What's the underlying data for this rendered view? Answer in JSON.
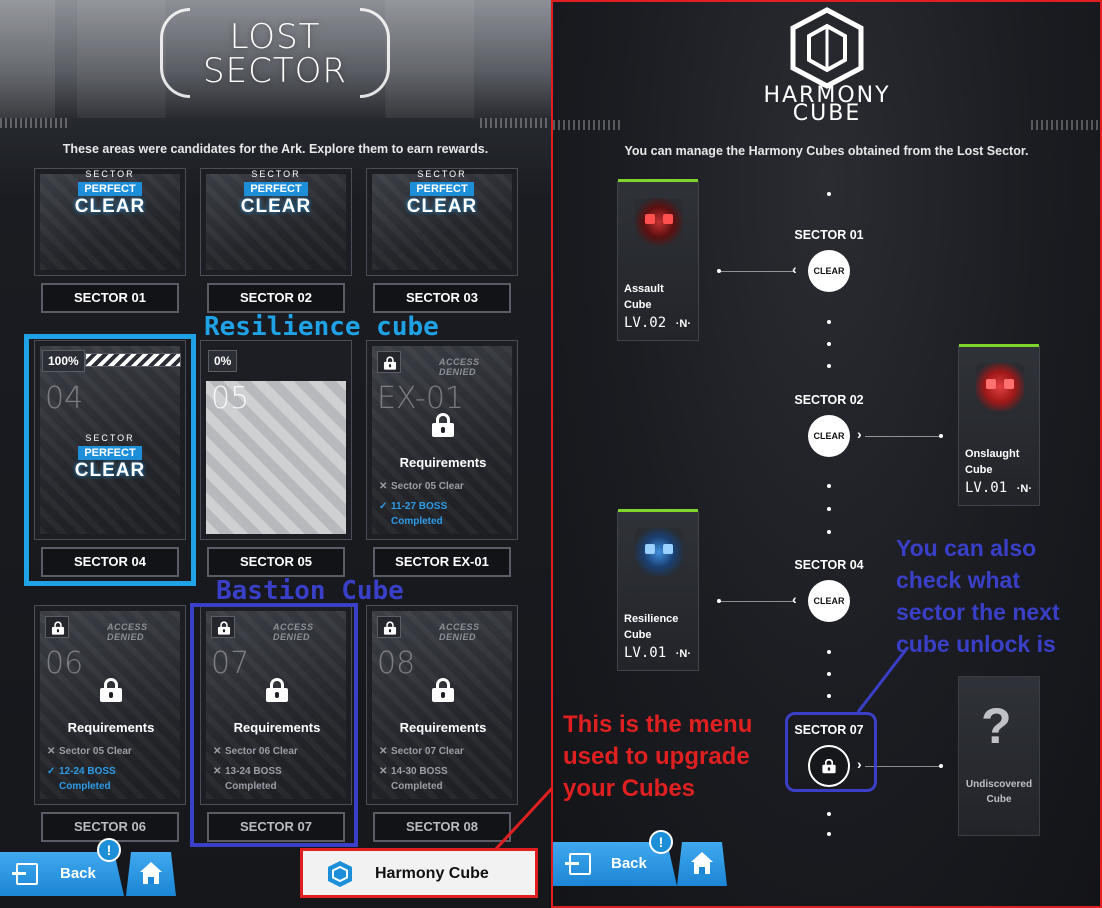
{
  "lost_sector": {
    "title_line1": "LOST",
    "title_line2": "SECTOR",
    "subtitle": "These areas were candidates for the Ark. Explore them to earn rewards.",
    "badge": {
      "sector": "SECTOR",
      "perfect": "PERFECT",
      "clear": "CLEAR"
    },
    "sectors": [
      {
        "label": "SECTOR 01",
        "state": "perfect_clear"
      },
      {
        "label": "SECTOR 02",
        "state": "perfect_clear"
      },
      {
        "label": "SECTOR 03",
        "state": "perfect_clear"
      },
      {
        "label": "SECTOR 04",
        "state": "perfect_clear",
        "number": "04",
        "progress": "100%"
      },
      {
        "label": "SECTOR 05",
        "state": "open",
        "number": "05",
        "progress": "0%"
      },
      {
        "label": "SECTOR EX-01",
        "state": "locked",
        "number": "EX-01",
        "access": "ACCESS DENIED",
        "req_title": "Requirements",
        "req1": "Sector 05 Clear",
        "req2a": "11-27 BOSS",
        "req2b": "Completed"
      },
      {
        "label": "SECTOR 06",
        "state": "locked",
        "number": "06",
        "access": "ACCESS DENIED",
        "req_title": "Requirements",
        "req1": "Sector 05 Clear",
        "req2a": "12-24 BOSS",
        "req2b": "Completed"
      },
      {
        "label": "SECTOR 07",
        "state": "locked",
        "number": "07",
        "access": "ACCESS DENIED",
        "req_title": "Requirements",
        "req1": "Sector 06 Clear",
        "req2a": "13-24 BOSS",
        "req2b": "Completed"
      },
      {
        "label": "SECTOR 08",
        "state": "locked",
        "number": "08",
        "access": "ACCESS DENIED",
        "req_title": "Requirements",
        "req1": "Sector 07 Clear",
        "req2a": "14-30 BOSS",
        "req2b": "Completed"
      }
    ],
    "back_label": "Back",
    "notif_mark": "!",
    "harmony_button_label": "Harmony Cube"
  },
  "annotations": {
    "resilience": "Resilience cube",
    "bastion": "Bastion Cube",
    "menu_note": [
      "This is the menu",
      "used to upgrade",
      "your Cubes"
    ],
    "next_note": [
      "You can also",
      "check what",
      "sector the next",
      "cube unlock is"
    ]
  },
  "harmony": {
    "title_line1": "HARMONY",
    "title_line2": "CUBE",
    "subtitle": "You can manage the Harmony Cubes obtained from the Lost Sector.",
    "nodes": [
      {
        "sector": "SECTOR 01",
        "status": "CLEAR"
      },
      {
        "sector": "SECTOR 02",
        "status": "CLEAR"
      },
      {
        "sector": "SECTOR 04",
        "status": "CLEAR"
      },
      {
        "sector": "SECTOR 07",
        "status": "locked"
      }
    ],
    "cubes": [
      {
        "name1": "Assault",
        "name2": "Cube",
        "level": "LV.02",
        "tag": "·N·",
        "color": "#d42a2a"
      },
      {
        "name1": "Onslaught",
        "name2": "Cube",
        "level": "LV.01",
        "tag": "·N·",
        "color": "#c52424"
      },
      {
        "name1": "Resilience",
        "name2": "Cube",
        "level": "LV.01",
        "tag": "·N·",
        "color": "#2a7fd8"
      },
      {
        "name1": "Undiscovered",
        "name2": "Cube",
        "mark": "?"
      }
    ],
    "back_label": "Back",
    "notif_mark": "!"
  },
  "colors": {
    "accent_blue": "#1d8fd8",
    "annot_cyan": "#1fa2e6",
    "annot_indigo": "#3a3fc8",
    "annot_red": "#e02020",
    "bar_green": "#7fd52b"
  }
}
